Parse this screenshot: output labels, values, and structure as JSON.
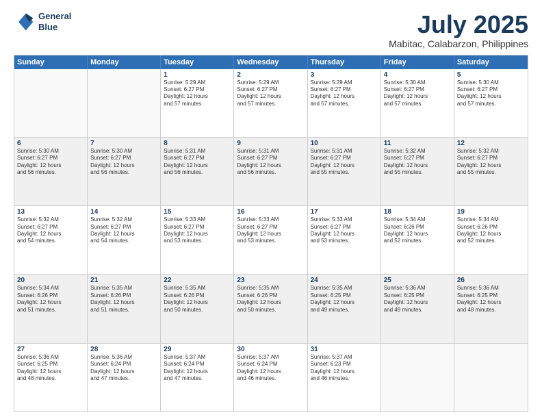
{
  "logo": {
    "line1": "General",
    "line2": "Blue"
  },
  "title": "July 2025",
  "subtitle": "Mabitac, Calabarzon, Philippines",
  "header_days": [
    "Sunday",
    "Monday",
    "Tuesday",
    "Wednesday",
    "Thursday",
    "Friday",
    "Saturday"
  ],
  "weeks": [
    {
      "cells": [
        {
          "day": "",
          "lines": [],
          "empty": true
        },
        {
          "day": "",
          "lines": [],
          "empty": true
        },
        {
          "day": "1",
          "lines": [
            "Sunrise: 5:29 AM",
            "Sunset: 6:27 PM",
            "Daylight: 12 hours",
            "and 57 minutes."
          ]
        },
        {
          "day": "2",
          "lines": [
            "Sunrise: 5:29 AM",
            "Sunset: 6:27 PM",
            "Daylight: 12 hours",
            "and 57 minutes."
          ]
        },
        {
          "day": "3",
          "lines": [
            "Sunrise: 5:29 AM",
            "Sunset: 6:27 PM",
            "Daylight: 12 hours",
            "and 57 minutes."
          ]
        },
        {
          "day": "4",
          "lines": [
            "Sunrise: 5:30 AM",
            "Sunset: 6:27 PM",
            "Daylight: 12 hours",
            "and 57 minutes."
          ]
        },
        {
          "day": "5",
          "lines": [
            "Sunrise: 5:30 AM",
            "Sunset: 6:27 PM",
            "Daylight: 12 hours",
            "and 57 minutes."
          ]
        }
      ]
    },
    {
      "cells": [
        {
          "day": "6",
          "lines": [
            "Sunrise: 5:30 AM",
            "Sunset: 6:27 PM",
            "Daylight: 12 hours",
            "and 56 minutes."
          ],
          "shaded": true
        },
        {
          "day": "7",
          "lines": [
            "Sunrise: 5:30 AM",
            "Sunset: 6:27 PM",
            "Daylight: 12 hours",
            "and 56 minutes."
          ],
          "shaded": true
        },
        {
          "day": "8",
          "lines": [
            "Sunrise: 5:31 AM",
            "Sunset: 6:27 PM",
            "Daylight: 12 hours",
            "and 56 minutes."
          ],
          "shaded": true
        },
        {
          "day": "9",
          "lines": [
            "Sunrise: 5:31 AM",
            "Sunset: 6:27 PM",
            "Daylight: 12 hours",
            "and 56 minutes."
          ],
          "shaded": true
        },
        {
          "day": "10",
          "lines": [
            "Sunrise: 5:31 AM",
            "Sunset: 6:27 PM",
            "Daylight: 12 hours",
            "and 55 minutes."
          ],
          "shaded": true
        },
        {
          "day": "11",
          "lines": [
            "Sunrise: 5:32 AM",
            "Sunset: 6:27 PM",
            "Daylight: 12 hours",
            "and 55 minutes."
          ],
          "shaded": true
        },
        {
          "day": "12",
          "lines": [
            "Sunrise: 5:32 AM",
            "Sunset: 6:27 PM",
            "Daylight: 12 hours",
            "and 55 minutes."
          ],
          "shaded": true
        }
      ]
    },
    {
      "cells": [
        {
          "day": "13",
          "lines": [
            "Sunrise: 5:32 AM",
            "Sunset: 6:27 PM",
            "Daylight: 12 hours",
            "and 54 minutes."
          ]
        },
        {
          "day": "14",
          "lines": [
            "Sunrise: 5:32 AM",
            "Sunset: 6:27 PM",
            "Daylight: 12 hours",
            "and 54 minutes."
          ]
        },
        {
          "day": "15",
          "lines": [
            "Sunrise: 5:33 AM",
            "Sunset: 6:27 PM",
            "Daylight: 12 hours",
            "and 53 minutes."
          ]
        },
        {
          "day": "16",
          "lines": [
            "Sunrise: 5:33 AM",
            "Sunset: 6:27 PM",
            "Daylight: 12 hours",
            "and 53 minutes."
          ]
        },
        {
          "day": "17",
          "lines": [
            "Sunrise: 5:33 AM",
            "Sunset: 6:27 PM",
            "Daylight: 12 hours",
            "and 53 minutes."
          ]
        },
        {
          "day": "18",
          "lines": [
            "Sunrise: 5:34 AM",
            "Sunset: 6:26 PM",
            "Daylight: 12 hours",
            "and 52 minutes."
          ]
        },
        {
          "day": "19",
          "lines": [
            "Sunrise: 5:34 AM",
            "Sunset: 6:26 PM",
            "Daylight: 12 hours",
            "and 52 minutes."
          ]
        }
      ]
    },
    {
      "cells": [
        {
          "day": "20",
          "lines": [
            "Sunrise: 5:34 AM",
            "Sunset: 6:26 PM",
            "Daylight: 12 hours",
            "and 51 minutes."
          ],
          "shaded": true
        },
        {
          "day": "21",
          "lines": [
            "Sunrise: 5:35 AM",
            "Sunset: 6:26 PM",
            "Daylight: 12 hours",
            "and 51 minutes."
          ],
          "shaded": true
        },
        {
          "day": "22",
          "lines": [
            "Sunrise: 5:35 AM",
            "Sunset: 6:26 PM",
            "Daylight: 12 hours",
            "and 50 minutes."
          ],
          "shaded": true
        },
        {
          "day": "23",
          "lines": [
            "Sunrise: 5:35 AM",
            "Sunset: 6:26 PM",
            "Daylight: 12 hours",
            "and 50 minutes."
          ],
          "shaded": true
        },
        {
          "day": "24",
          "lines": [
            "Sunrise: 5:35 AM",
            "Sunset: 6:25 PM",
            "Daylight: 12 hours",
            "and 49 minutes."
          ],
          "shaded": true
        },
        {
          "day": "25",
          "lines": [
            "Sunrise: 5:36 AM",
            "Sunset: 6:25 PM",
            "Daylight: 12 hours",
            "and 49 minutes."
          ],
          "shaded": true
        },
        {
          "day": "26",
          "lines": [
            "Sunrise: 5:36 AM",
            "Sunset: 6:25 PM",
            "Daylight: 12 hours",
            "and 48 minutes."
          ],
          "shaded": true
        }
      ]
    },
    {
      "cells": [
        {
          "day": "27",
          "lines": [
            "Sunrise: 5:36 AM",
            "Sunset: 6:25 PM",
            "Daylight: 12 hours",
            "and 48 minutes."
          ]
        },
        {
          "day": "28",
          "lines": [
            "Sunrise: 5:36 AM",
            "Sunset: 6:24 PM",
            "Daylight: 12 hours",
            "and 47 minutes."
          ]
        },
        {
          "day": "29",
          "lines": [
            "Sunrise: 5:37 AM",
            "Sunset: 6:24 PM",
            "Daylight: 12 hours",
            "and 47 minutes."
          ]
        },
        {
          "day": "30",
          "lines": [
            "Sunrise: 5:37 AM",
            "Sunset: 6:24 PM",
            "Daylight: 12 hours",
            "and 46 minutes."
          ]
        },
        {
          "day": "31",
          "lines": [
            "Sunrise: 5:37 AM",
            "Sunset: 6:23 PM",
            "Daylight: 12 hours",
            "and 46 minutes."
          ]
        },
        {
          "day": "",
          "lines": [],
          "empty": true
        },
        {
          "day": "",
          "lines": [],
          "empty": true
        }
      ]
    }
  ]
}
